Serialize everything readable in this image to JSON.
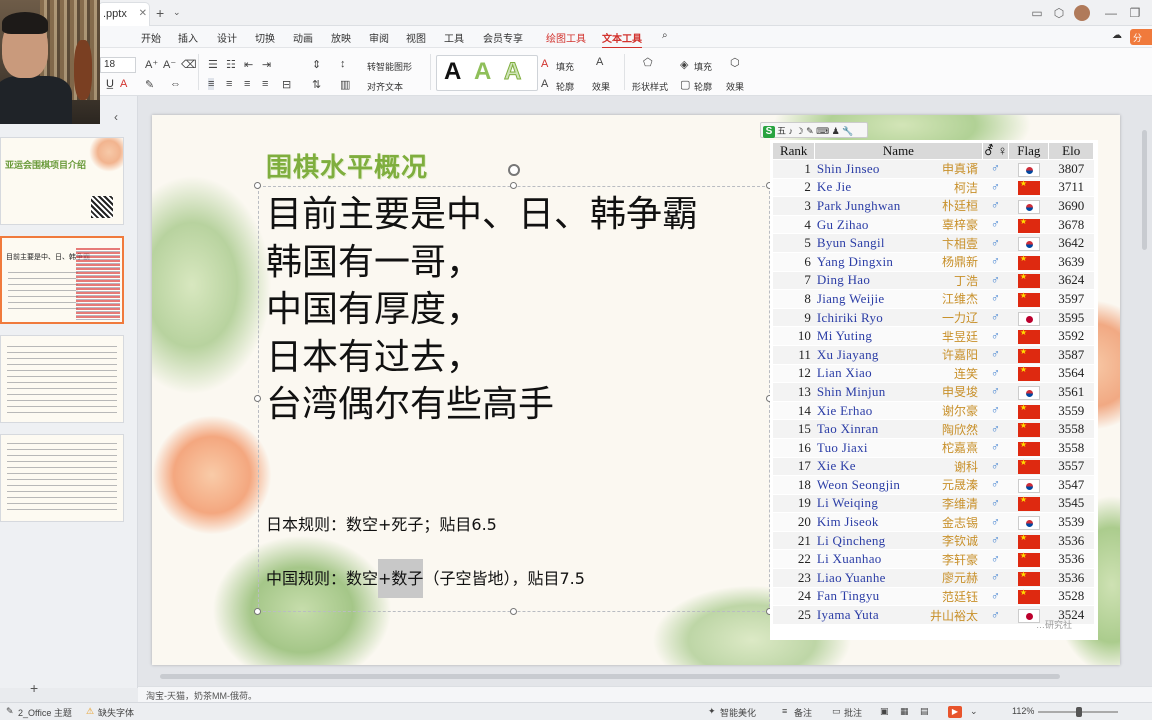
{
  "window": {
    "doc_tab": ".pptx",
    "new_tab": "+",
    "tab_drop": "⌄"
  },
  "menu": {
    "items": [
      "开始",
      "插入",
      "设计",
      "切换",
      "动画",
      "放映",
      "审阅",
      "视图",
      "工具",
      "会员专享",
      "绘图工具",
      "文本工具"
    ],
    "active": "文本工具",
    "share": "分"
  },
  "ribbon": {
    "font_size": "18",
    "convert_smartart": "转智能图形",
    "text_direction": "对齐文本",
    "fill": "填充",
    "outline": "轮廓",
    "effect": "效果",
    "shape_style": "形状样式",
    "shape_fill": "填充",
    "shape_outline": "轮廓",
    "shape_effect": "效果",
    "wordart": [
      "A",
      "A",
      "A"
    ]
  },
  "slide": {
    "title": "围棋水平概况",
    "lines": [
      "目前主要是中、日、韩争霸",
      "韩国有一哥，",
      "中国有厚度，",
      "日本有过去，",
      "台湾偶尔有些高手"
    ],
    "japan_rule": "日本规则：数空+死子；贴目6.5",
    "china_rule_a": "中国规则：数空",
    "china_rule_b": "+数子",
    "china_rule_c": "（子空皆地），贴目7.5"
  },
  "mini_toolbar": "五 ♪ ☽ ✎ ⌨ ♟ 🔧",
  "table": {
    "headers": [
      "Rank",
      "Name",
      "⚦ ♀",
      "Flag",
      "Elo"
    ],
    "rows": [
      {
        "rank": "1",
        "name": "Shin Jinseo",
        "cn": "申真谞",
        "flag": "kr",
        "elo": "3807"
      },
      {
        "rank": "2",
        "name": "Ke Jie",
        "cn": "柯洁",
        "flag": "cn",
        "elo": "3711"
      },
      {
        "rank": "3",
        "name": "Park Junghwan",
        "cn": "朴廷桓",
        "flag": "kr",
        "elo": "3690"
      },
      {
        "rank": "4",
        "name": "Gu Zihao",
        "cn": "辜梓豪",
        "flag": "cn",
        "elo": "3678"
      },
      {
        "rank": "5",
        "name": "Byun Sangil",
        "cn": "卞相壹",
        "flag": "kr",
        "elo": "3642"
      },
      {
        "rank": "6",
        "name": "Yang Dingxin",
        "cn": "杨鼎新",
        "flag": "cn",
        "elo": "3639"
      },
      {
        "rank": "7",
        "name": "Ding Hao",
        "cn": "丁浩",
        "flag": "cn",
        "elo": "3624"
      },
      {
        "rank": "8",
        "name": "Jiang Weijie",
        "cn": "江维杰",
        "flag": "cn",
        "elo": "3597"
      },
      {
        "rank": "9",
        "name": "Ichiriki Ryo",
        "cn": "一力辽",
        "flag": "jp",
        "elo": "3595"
      },
      {
        "rank": "10",
        "name": "Mi Yuting",
        "cn": "芈昱廷",
        "flag": "cn",
        "elo": "3592"
      },
      {
        "rank": "11",
        "name": "Xu Jiayang",
        "cn": "许嘉阳",
        "flag": "cn",
        "elo": "3587"
      },
      {
        "rank": "12",
        "name": "Lian Xiao",
        "cn": "连笑",
        "flag": "cn",
        "elo": "3564"
      },
      {
        "rank": "13",
        "name": "Shin Minjun",
        "cn": "申旻埈",
        "flag": "kr",
        "elo": "3561"
      },
      {
        "rank": "14",
        "name": "Xie Erhao",
        "cn": "谢尔豪",
        "flag": "cn",
        "elo": "3559"
      },
      {
        "rank": "15",
        "name": "Tao Xinran",
        "cn": "陶欣然",
        "flag": "cn",
        "elo": "3558"
      },
      {
        "rank": "16",
        "name": "Tuo Jiaxi",
        "cn": "柁嘉熹",
        "flag": "cn",
        "elo": "3558"
      },
      {
        "rank": "17",
        "name": "Xie Ke",
        "cn": "谢科",
        "flag": "cn",
        "elo": "3557"
      },
      {
        "rank": "18",
        "name": "Weon Seongjin",
        "cn": "元晟溱",
        "flag": "kr",
        "elo": "3547"
      },
      {
        "rank": "19",
        "name": "Li Weiqing",
        "cn": "李维清",
        "flag": "cn",
        "elo": "3545"
      },
      {
        "rank": "20",
        "name": "Kim Jiseok",
        "cn": "金志锡",
        "flag": "kr",
        "elo": "3539"
      },
      {
        "rank": "21",
        "name": "Li Qincheng",
        "cn": "李钦诚",
        "flag": "cn",
        "elo": "3536"
      },
      {
        "rank": "22",
        "name": "Li Xuanhao",
        "cn": "李轩豪",
        "flag": "cn",
        "elo": "3536"
      },
      {
        "rank": "23",
        "name": "Liao Yuanhe",
        "cn": "廖元赫",
        "flag": "cn",
        "elo": "3536"
      },
      {
        "rank": "24",
        "name": "Fan Tingyu",
        "cn": "范廷钰",
        "flag": "cn",
        "elo": "3528"
      },
      {
        "rank": "25",
        "name": "Iyama Yuta",
        "cn": "井山裕太",
        "flag": "jp",
        "elo": "3524"
      }
    ]
  },
  "watermark": "…研究社",
  "thumbnails": [
    {
      "title": "亚运会围棋项目介绍"
    },
    {
      "title": "目前主要是中、日、韩争霸"
    },
    {
      "title": ""
    },
    {
      "title": ""
    }
  ],
  "notes": "淘宝-天猫，奶茶MM-俄荷。",
  "status": {
    "theme": "2_Office 主题",
    "missing_font": "缺失字体",
    "beautify": "智能美化",
    "notes_btn": "备注",
    "comments": "批注",
    "zoom": "112%"
  },
  "colors": {
    "title_green": "#7fae3e",
    "accent": "#d2322d",
    "name_blue": "#2b3da6",
    "cn_gold": "#c8902a"
  }
}
